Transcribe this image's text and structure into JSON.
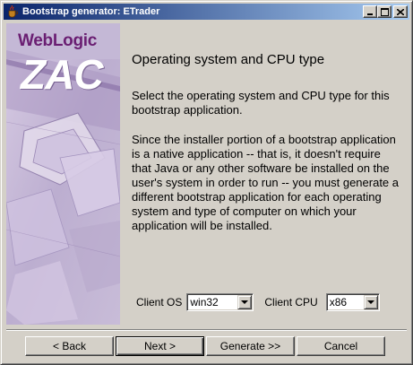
{
  "window": {
    "title": "Bootstrap generator: ETrader",
    "icon": "java-cup-icon",
    "controls": [
      "minimize-icon",
      "maximize-icon",
      "close-icon"
    ]
  },
  "side_panel": {
    "logo_text": "WebLogic",
    "product_text": "ZAC",
    "colors": {
      "background": "#c8bcd8",
      "logo_text": "#6a1e72",
      "zac_text": "#ffffff"
    }
  },
  "main": {
    "heading": "Operating system and CPU type",
    "intro": "Select the operating system and CPU type for this bootstrap application.",
    "body": "Since the installer portion of a bootstrap application is a native application -- that is, it doesn't require that Java or any other software be installed on the user's system in order to run -- you must generate a different bootstrap application for each operating system and type of computer on which your application will be installed."
  },
  "os_select": {
    "label": "Client OS",
    "value": "win32"
  },
  "cpu_select": {
    "label": "Client CPU",
    "value": "x86"
  },
  "buttons": {
    "back": "< Back",
    "next": "Next >",
    "generate": "Generate >>",
    "cancel": "Cancel"
  },
  "colors": {
    "title_gradient_start": "#0a246a",
    "title_gradient_end": "#a6caf0",
    "face": "#d4d0c8"
  }
}
